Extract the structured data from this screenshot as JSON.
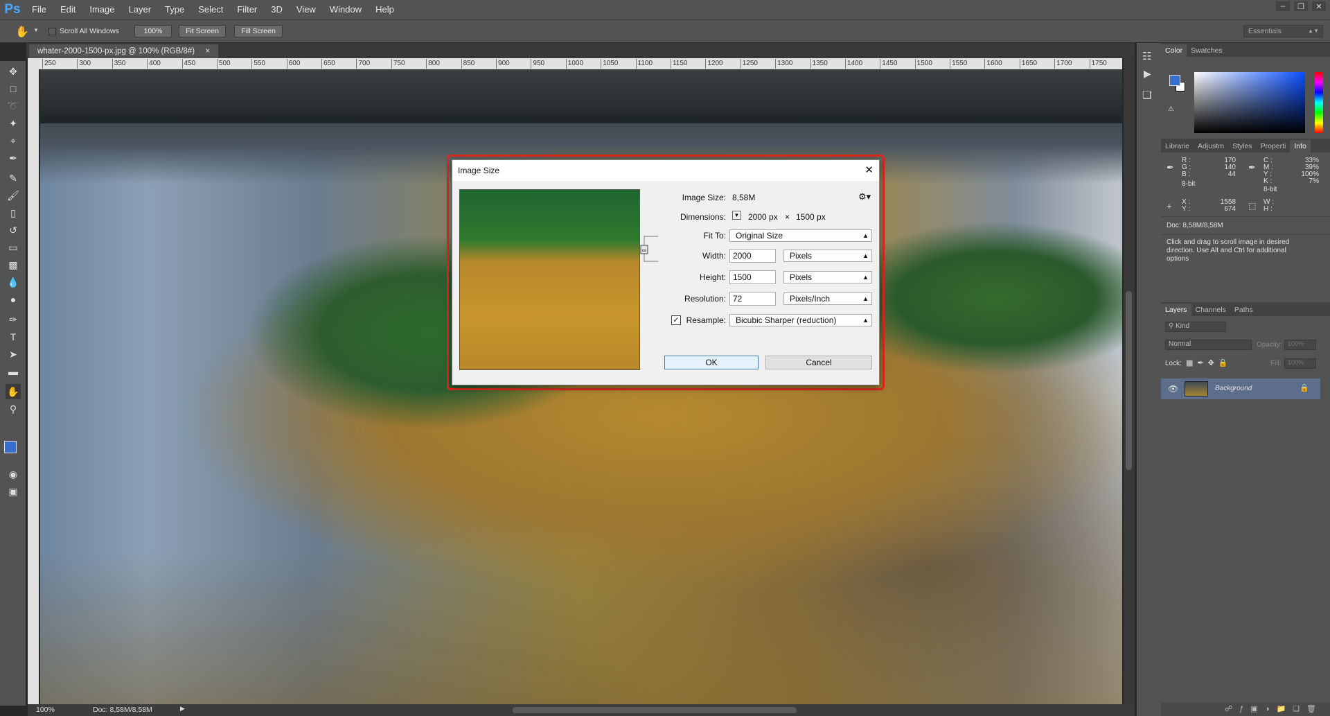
{
  "app": {
    "logo": "Ps",
    "menu": [
      "File",
      "Edit",
      "Image",
      "Layer",
      "Type",
      "Select",
      "Filter",
      "3D",
      "View",
      "Window",
      "Help"
    ],
    "window_controls": [
      "–",
      "❐",
      "✕"
    ]
  },
  "options_bar": {
    "scroll_all_windows": "Scroll All Windows",
    "zoom_100": "100%",
    "fit_screen": "Fit Screen",
    "fill_screen": "Fill Screen",
    "workspace": "Essentials"
  },
  "document": {
    "tab_title": "whater-2000-1500-px.jpg @ 100% (RGB/8#)",
    "tab_close": "×",
    "ruler_ticks": [
      "250",
      "300",
      "350",
      "400",
      "450",
      "500",
      "550",
      "600",
      "650",
      "700",
      "750",
      "800",
      "850",
      "900",
      "950",
      "1000",
      "1050",
      "1100",
      "1150",
      "1200",
      "1250",
      "1300",
      "1350",
      "1400",
      "1450",
      "1500",
      "1550",
      "1600",
      "1650",
      "1700",
      "1750"
    ],
    "zoom": "100%",
    "doc_info": "Doc: 8,58M/8,58M"
  },
  "right_panels": {
    "color_tabs": [
      "Color",
      "Swatches"
    ],
    "info_tabs": [
      "Librarie",
      "Adjustm",
      "Styles",
      "Properti",
      "Info"
    ],
    "info": {
      "R": "170",
      "G": "140",
      "B": "44",
      "bit_left": "8-bit",
      "C": "33%",
      "M": "39%",
      "Y": "100%",
      "K": "7%",
      "bit_right": "8-bit",
      "X": "1558",
      "Yc": "674",
      "W": "",
      "H": "",
      "doc": "Doc: 8,58M/8,58M",
      "hint": "Click and drag to scroll image in desired direction.  Use Alt and Ctrl for additional options"
    },
    "layer_tabs": [
      "Layers",
      "Channels",
      "Paths"
    ],
    "layers": {
      "kind": "Kind",
      "blend_mode": "Normal",
      "opacity_label": "Opacity:",
      "opacity_value": "100%",
      "lock_label": "Lock:",
      "fill_label": "Fill:",
      "fill_value": "100%",
      "items": [
        {
          "name": "Background"
        }
      ]
    }
  },
  "dialog": {
    "title": "Image Size",
    "close": "✕",
    "image_size_label": "Image Size:",
    "image_size_value": "8,58M",
    "dimensions_label": "Dimensions:",
    "dim_width": "2000 px",
    "dim_x": "×",
    "dim_height": "1500 px",
    "fit_to_label": "Fit To:",
    "fit_to_value": "Original Size",
    "width_label": "Width:",
    "width_value": "2000",
    "width_unit": "Pixels",
    "height_label": "Height:",
    "height_value": "1500",
    "height_unit": "Pixels",
    "resolution_label": "Resolution:",
    "resolution_value": "72",
    "resolution_unit": "Pixels/Inch",
    "resample_label": "Resample:",
    "resample_value": "Bicubic Sharper (reduction)",
    "resample_checked": true,
    "ok": "OK",
    "cancel": "Cancel"
  },
  "colors": {
    "accent_outline": "#e02a20",
    "foreground": "#3a6ecc",
    "background": "#ffffff"
  }
}
